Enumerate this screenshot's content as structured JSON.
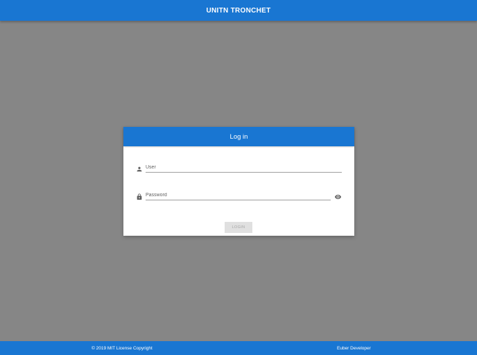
{
  "app_bar": {
    "title": "UNITN TRONCHET"
  },
  "login_card": {
    "title": "Log in",
    "user_field": {
      "icon": "person-icon",
      "placeholder": "User",
      "value": ""
    },
    "password_field": {
      "icon": "lock-icon",
      "placeholder": "Password",
      "value": "",
      "toggle_icon": "eye-icon"
    },
    "login_button": {
      "label": "LOGIN",
      "state": "disabled"
    }
  },
  "footer": {
    "copyright": "© 2019 MIT License Copyright",
    "developer": "Euber Developer"
  },
  "colors": {
    "primary": "#1976d2",
    "background": "#868686",
    "card": "#ffffff",
    "disabled_button": "#e0e0e0"
  }
}
